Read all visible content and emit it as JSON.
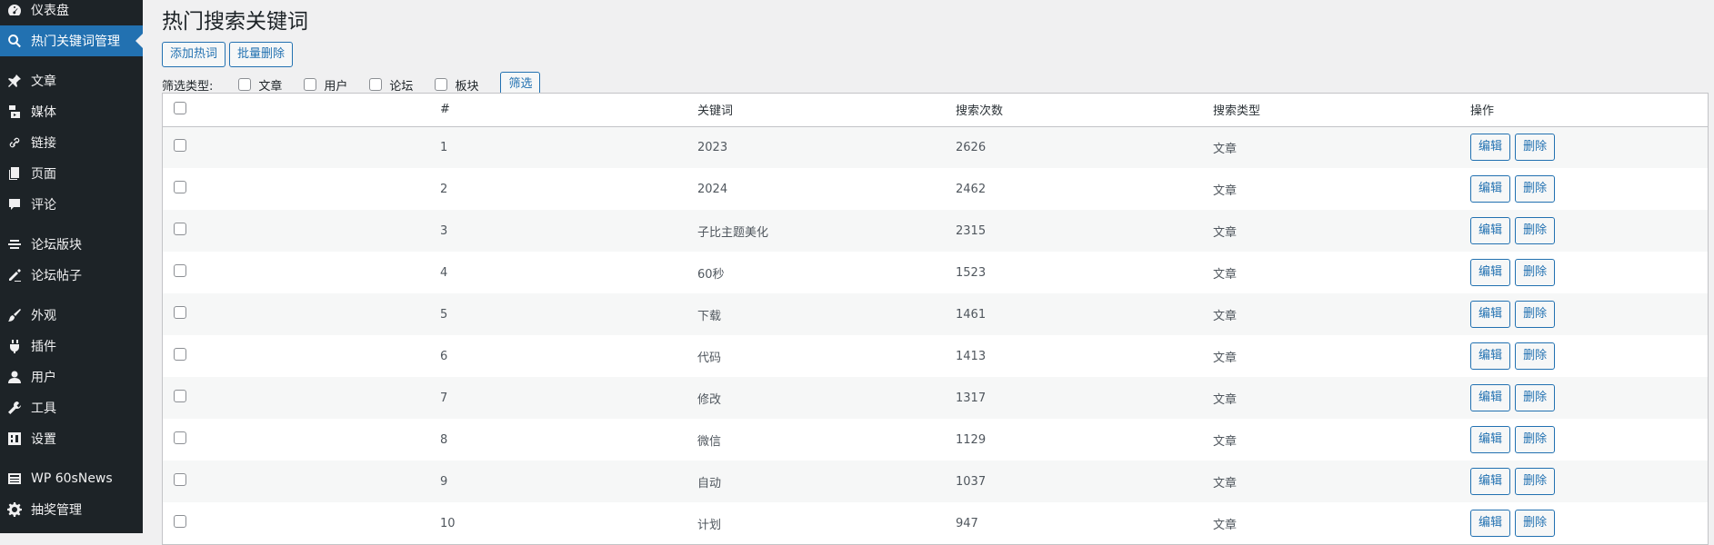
{
  "sidebar": {
    "items": [
      {
        "label": "仪表盘",
        "icon": "dashboard-icon"
      },
      {
        "label": "热门关键词管理",
        "icon": "search-icon",
        "active": true
      },
      {
        "label": "文章",
        "icon": "pin-icon"
      },
      {
        "label": "媒体",
        "icon": "media-icon"
      },
      {
        "label": "链接",
        "icon": "link-icon"
      },
      {
        "label": "页面",
        "icon": "pages-icon"
      },
      {
        "label": "评论",
        "icon": "comment-icon"
      },
      {
        "label": "论坛版块",
        "icon": "forum-icon"
      },
      {
        "label": "论坛帖子",
        "icon": "forum-post-icon"
      },
      {
        "label": "外观",
        "icon": "appearance-icon"
      },
      {
        "label": "插件",
        "icon": "plugin-icon"
      },
      {
        "label": "用户",
        "icon": "user-icon"
      },
      {
        "label": "工具",
        "icon": "tools-icon"
      },
      {
        "label": "设置",
        "icon": "settings-icon"
      },
      {
        "label": "WP 60sNews",
        "icon": "news-icon"
      },
      {
        "label": "抽奖管理",
        "icon": "gear-icon"
      }
    ]
  },
  "page": {
    "title": "热门搜索关键词",
    "add_label": "添加热词",
    "bulk_delete_label": "批量删除",
    "filter_label": "筛选类型:",
    "filter_options": [
      "文章",
      "用户",
      "论坛",
      "板块"
    ],
    "filter_button": "筛选"
  },
  "table": {
    "headers": [
      "#",
      "关键词",
      "搜索次数",
      "搜索类型",
      "操作"
    ],
    "edit_label": "编辑",
    "delete_label": "删除",
    "rows": [
      {
        "num": "1",
        "keyword": "2023",
        "count": "2626",
        "type": "文章"
      },
      {
        "num": "2",
        "keyword": "2024",
        "count": "2462",
        "type": "文章"
      },
      {
        "num": "3",
        "keyword": "子比主题美化",
        "count": "2315",
        "type": "文章"
      },
      {
        "num": "4",
        "keyword": "60秒",
        "count": "1523",
        "type": "文章"
      },
      {
        "num": "5",
        "keyword": "下载",
        "count": "1461",
        "type": "文章"
      },
      {
        "num": "6",
        "keyword": "代码",
        "count": "1413",
        "type": "文章"
      },
      {
        "num": "7",
        "keyword": "修改",
        "count": "1317",
        "type": "文章"
      },
      {
        "num": "8",
        "keyword": "微信",
        "count": "1129",
        "type": "文章"
      },
      {
        "num": "9",
        "keyword": "自动",
        "count": "1037",
        "type": "文章"
      },
      {
        "num": "10",
        "keyword": "计划",
        "count": "947",
        "type": "文章"
      }
    ]
  }
}
